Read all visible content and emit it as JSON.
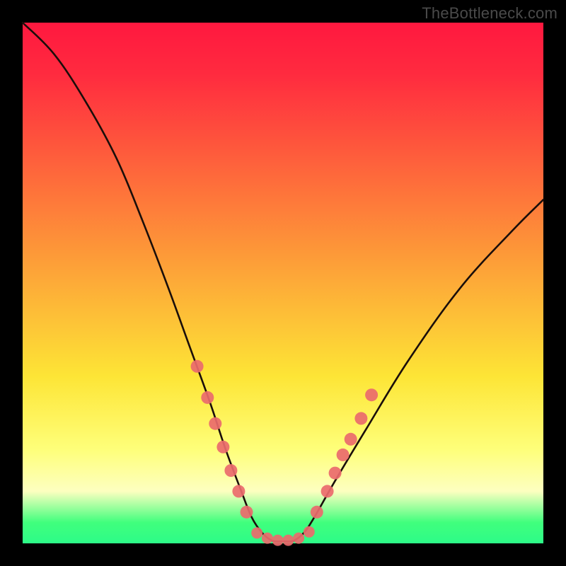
{
  "watermark": "TheBottleneck.com",
  "colors": {
    "top": "#ff183f",
    "red": "#ff2b3f",
    "orange": "#fd9b38",
    "yellow": "#fde536",
    "pale": "#feff7a",
    "pale2": "#fdffc0",
    "green": "#40ff7d",
    "green2": "#2dfb88",
    "curve": "#1a0e0a",
    "marker": "#ea6a6c"
  },
  "chart_data": {
    "type": "line",
    "title": "",
    "xlabel": "",
    "ylabel": "",
    "x_range": [
      0,
      100
    ],
    "y_range": [
      0,
      100
    ],
    "curve": {
      "name": "bottleneck-curve",
      "x": [
        0,
        6,
        12,
        18,
        23,
        28,
        32,
        36,
        39,
        42,
        44,
        46,
        48,
        50,
        52,
        54,
        56,
        60,
        66,
        74,
        84,
        94,
        100
      ],
      "y": [
        100,
        94,
        85,
        74,
        62,
        49,
        38,
        27,
        18,
        10,
        5,
        2,
        0.5,
        0.4,
        0.5,
        2,
        5,
        12,
        22,
        35,
        49,
        60,
        66
      ]
    },
    "markers_left": {
      "name": "left-branch-dots",
      "x": [
        33.5,
        35.5,
        37.0,
        38.5,
        40.0,
        41.5,
        43.0
      ],
      "y": [
        34.0,
        28.0,
        23.0,
        18.5,
        14.0,
        10.0,
        6.0
      ]
    },
    "markers_right": {
      "name": "right-branch-dots",
      "x": [
        56.5,
        58.5,
        60.0,
        61.5,
        63.0,
        65.0,
        67.0
      ],
      "y": [
        6.0,
        10.0,
        13.5,
        17.0,
        20.0,
        24.0,
        28.5
      ]
    },
    "markers_bottom": {
      "name": "valley-flat-dots",
      "x": [
        45.0,
        47.0,
        49.0,
        51.0,
        53.0,
        55.0
      ],
      "y": [
        2.0,
        1.0,
        0.6,
        0.6,
        1.0,
        2.2
      ]
    }
  }
}
